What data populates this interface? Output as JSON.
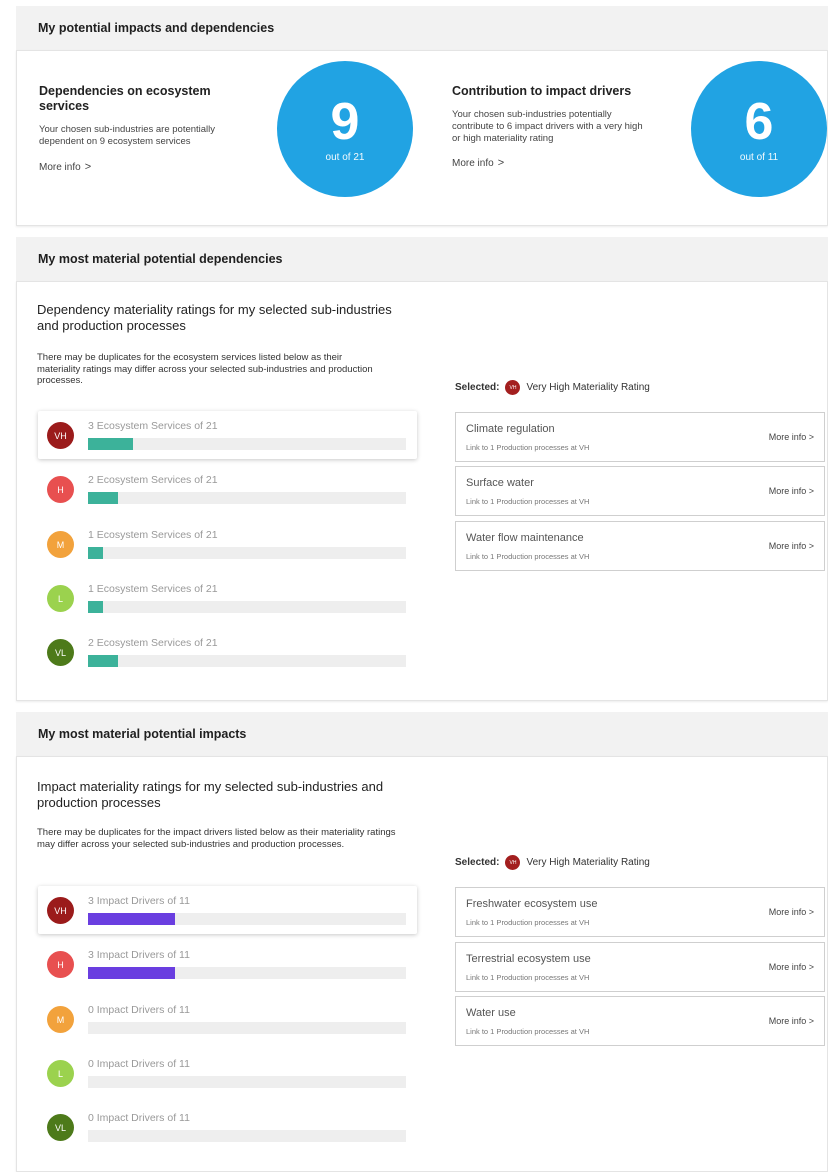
{
  "summary": {
    "header": "My potential impacts and dependencies",
    "dependencies": {
      "title": "Dependencies on ecosystem services",
      "desc": "Your chosen sub-industries are potentially dependent on 9 ecosystem services",
      "more": "More info",
      "count": "9",
      "out_of": "out of 21"
    },
    "impacts": {
      "title": "Contribution to impact drivers",
      "desc": "Your chosen sub-industries potentially contribute to 6 impact drivers with a very high or high materiality rating",
      "more": "More info",
      "count": "6",
      "out_of": "out of 11"
    }
  },
  "dependencies_section": {
    "header": "My most material potential dependencies",
    "subtitle": "Dependency materiality ratings for my selected sub-industries and production processes",
    "note": "There may be duplicates for the ecosystem services listed below as their materiality ratings may differ across your selected sub-industries and production processes.",
    "rows": [
      {
        "badge": "VH",
        "label": "3 Ecosystem Services of 21",
        "fraction": 0.1429,
        "color": "#9b1b1b"
      },
      {
        "badge": "H",
        "label": "2 Ecosystem Services of 21",
        "fraction": 0.0952,
        "color": "#e85050"
      },
      {
        "badge": "M",
        "label": "1 Ecosystem Services of 21",
        "fraction": 0.0476,
        "color": "#f2a23c"
      },
      {
        "badge": "L",
        "label": "1 Ecosystem Services of 21",
        "fraction": 0.0476,
        "color": "#9bd24e"
      },
      {
        "badge": "VL",
        "label": "2 Ecosystem Services of 21",
        "fraction": 0.0952,
        "color": "#4d7a1a"
      }
    ],
    "bar_color": "#3cb29a",
    "selected_label": "Selected:",
    "selected_badge": "VH",
    "selected_text": "Very High Materiality Rating",
    "items": [
      {
        "name": "Climate regulation",
        "link": "Link to 1 Production processes at VH",
        "more": "More info >"
      },
      {
        "name": "Surface water",
        "link": "Link to 1 Production processes at VH",
        "more": "More info >"
      },
      {
        "name": "Water flow maintenance",
        "link": "Link to 1 Production processes at VH",
        "more": "More info >"
      }
    ]
  },
  "impacts_section": {
    "header": "My most material potential impacts",
    "subtitle": "Impact materiality ratings for my selected sub-industries and production processes",
    "note": "There may be duplicates for the impact drivers listed below as their materiality ratings may differ across your selected sub-industries and production processes.",
    "rows": [
      {
        "badge": "VH",
        "label": "3 Impact Drivers of 11",
        "fraction": 0.2727,
        "color": "#9b1b1b"
      },
      {
        "badge": "H",
        "label": "3 Impact Drivers of 11",
        "fraction": 0.2727,
        "color": "#e85050"
      },
      {
        "badge": "M",
        "label": "0 Impact Drivers of 11",
        "fraction": 0,
        "color": "#f2a23c"
      },
      {
        "badge": "L",
        "label": "0 Impact Drivers of 11",
        "fraction": 0,
        "color": "#9bd24e"
      },
      {
        "badge": "VL",
        "label": "0 Impact Drivers of 11",
        "fraction": 0,
        "color": "#4d7a1a"
      }
    ],
    "bar_color": "#6a3ee0",
    "selected_label": "Selected:",
    "selected_badge": "VH",
    "selected_text": "Very High Materiality Rating",
    "items": [
      {
        "name": "Freshwater ecosystem use",
        "link": "Link to 1 Production processes at VH",
        "more": "More info >"
      },
      {
        "name": "Terrestrial ecosystem use",
        "link": "Link to 1 Production processes at VH",
        "more": "More info >"
      },
      {
        "name": "Water use",
        "link": "Link to 1 Production processes at VH",
        "more": "More info >"
      }
    ]
  }
}
